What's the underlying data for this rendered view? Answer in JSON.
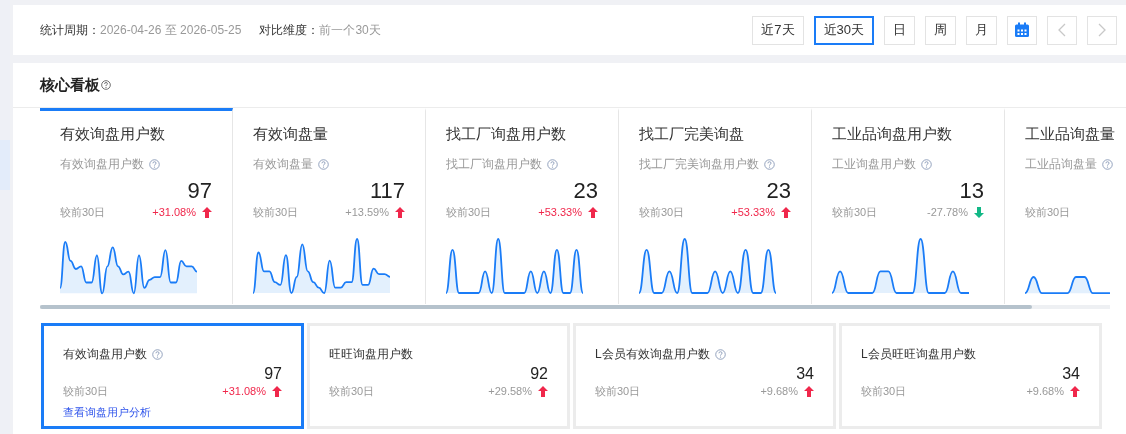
{
  "filter_bar": {
    "period_label": "统计周期：",
    "period_value": "2026-04-26 至 2026-05-25",
    "compare_label": "对比维度：",
    "compare_value": "前一个30天",
    "ranges": [
      {
        "label": "近7天",
        "selected": false
      },
      {
        "label": "近30天",
        "selected": true
      },
      {
        "label": "日",
        "selected": false
      },
      {
        "label": "周",
        "selected": false
      },
      {
        "label": "月",
        "selected": false
      }
    ],
    "nav": [
      {
        "kind": "calendar"
      },
      {
        "kind": "prev",
        "disabled": true
      },
      {
        "kind": "next",
        "disabled": true
      }
    ]
  },
  "dashboard": {
    "title": "核心看板",
    "help": true,
    "tabs": [
      {
        "title": "有效询盘用户数",
        "subtitle": "有效询盘用户数",
        "help": true,
        "value": "97",
        "compare_label": "较前30日",
        "change": "+31.08%",
        "rising": true,
        "highlighted": true,
        "selected": true
      },
      {
        "title": "有效询盘量",
        "subtitle": "有效询盘量",
        "help": true,
        "value": "117",
        "compare_label": "较前30日",
        "change": "+13.59%",
        "rising": true,
        "highlighted": false,
        "selected": false
      },
      {
        "title": "找工厂询盘用户数",
        "subtitle": "找工厂询盘用户数",
        "help": true,
        "value": "23",
        "compare_label": "较前30日",
        "change": "+53.33%",
        "rising": true,
        "highlighted": true,
        "selected": false
      },
      {
        "title": "找工厂完美询盘",
        "subtitle": "找工厂完美询盘用户数",
        "help": true,
        "value": "23",
        "compare_label": "较前30日",
        "change": "+53.33%",
        "rising": true,
        "highlighted": true,
        "selected": false
      },
      {
        "title": "工业品询盘用户数",
        "subtitle": "工业询盘用户数",
        "help": true,
        "value": "13",
        "compare_label": "较前30日",
        "change": "-27.78%",
        "rising": false,
        "highlighted": false,
        "selected": false
      },
      {
        "title": "工业品询盘量",
        "subtitle": "工业品询盘量",
        "help": true,
        "compare_label": "较前30日",
        "selected": false
      }
    ],
    "cards": [
      {
        "title": "有效询盘用户数",
        "help": true,
        "value": "97",
        "compare_label": "较前30日",
        "change": "+31.08%",
        "rising": true,
        "highlighted": true,
        "selected": true,
        "link": "查看询盘用户分析"
      },
      {
        "title": "旺旺询盘用户数",
        "help": false,
        "value": "92",
        "compare_label": "较前30日",
        "change": "+29.58%",
        "rising": true,
        "highlighted": false,
        "selected": false
      },
      {
        "title": "L会员有效询盘用户数",
        "help": true,
        "value": "34",
        "compare_label": "较前30日",
        "change": "+9.68%",
        "rising": true,
        "highlighted": false,
        "selected": false
      },
      {
        "title": "L会员旺旺询盘用户数",
        "help": false,
        "value": "34",
        "compare_label": "较前30日",
        "change": "+9.68%",
        "rising": true,
        "highlighted": false,
        "selected": false
      }
    ]
  }
}
